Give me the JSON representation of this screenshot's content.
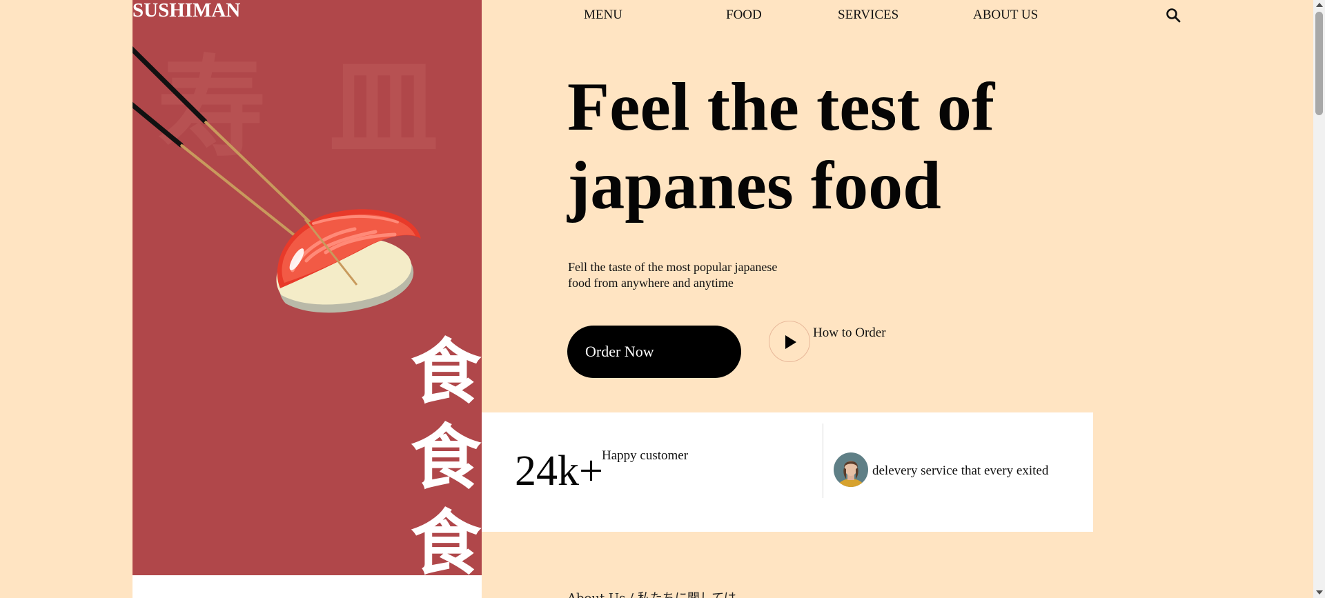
{
  "brand": {
    "logo": "SUSHIMAN"
  },
  "nav": {
    "items": [
      "MENU",
      "FOOD",
      "SERVICES",
      "ABOUT US"
    ],
    "search_icon": "search-icon"
  },
  "hero": {
    "background_kanji": "寿 皿",
    "vertical_kanji": [
      "食",
      "食",
      "食"
    ],
    "title_line1": "Feel the test of",
    "title_line2": "japanes food",
    "subtitle_line1": "Fell the taste of the most popular japanese",
    "subtitle_line2": "food from anywhere and anytime",
    "order_button": "Order Now",
    "how_to_order": "How to Order",
    "play_icon": "play-icon"
  },
  "stats": {
    "number": "24k+",
    "label": "Happy customer",
    "delivery_text": "delevery service that every exited"
  },
  "about": {
    "heading": "About Us / 私たちに関しては"
  },
  "colors": {
    "page_bg": "#ffe4c2",
    "panel_red": "#b0474a",
    "button_black": "#000000",
    "card_white": "#ffffff"
  }
}
